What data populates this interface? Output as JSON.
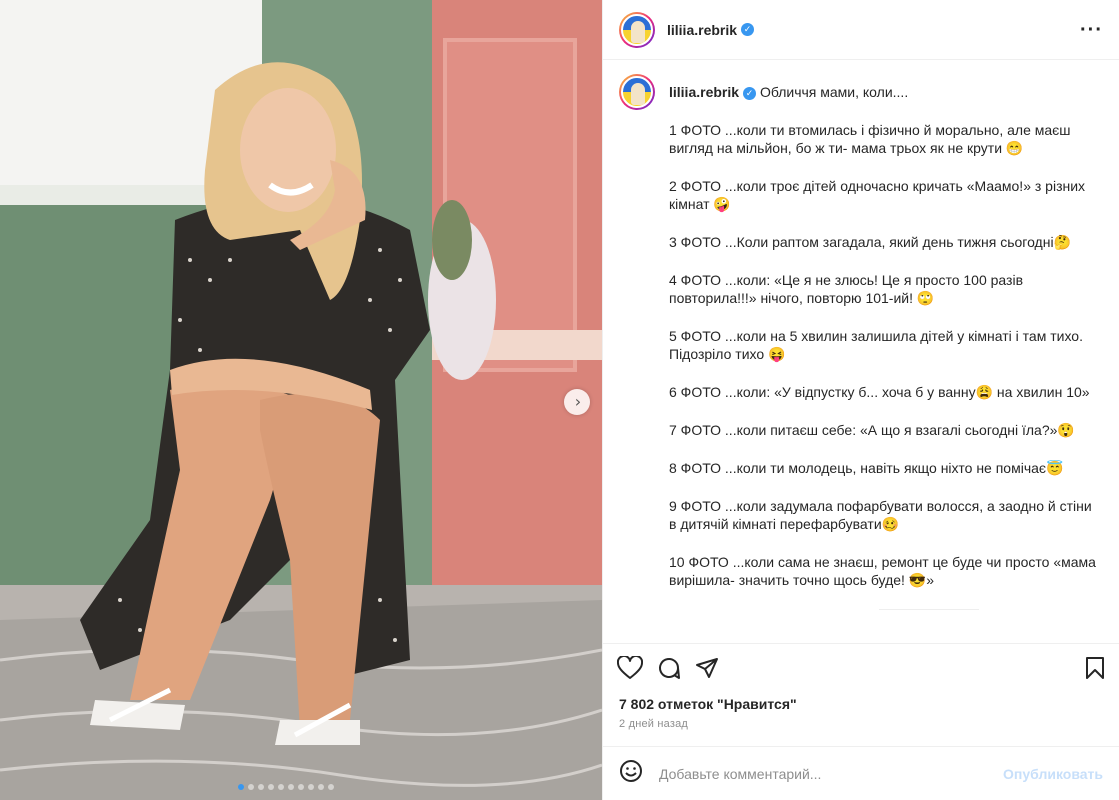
{
  "post": {
    "username": "liliia.rebrik",
    "verified_icon": "verified-badge-icon",
    "more_icon": "more-options-icon",
    "caption_title": "Обличчя мами, коли....",
    "caption_paragraphs": [
      "1 ФОТО ...коли ти втомилась і фізично й морально, але маєш вигляд на мільйон, бо ж ти- мама трьох як не крути 😁",
      "2 ФОТО ...коли троє дітей одночасно кричать «Маамо!» з різних кімнат 🤪",
      "3 ФОТО ...Коли раптом загадала, який день тижня сьогодні🤔",
      "4 ФОТО ...коли: «Це я не злюсь! Це я просто 100 разів повторила!!!» нічого, повторю 101-ий! 🙄",
      "5 ФОТО ...коли на 5 хвилин залишила дітей у кімнаті і там тихо.\nПідозріло тихо 😝",
      "6 ФОТО ...коли: «У відпустку б... хоча б у ванну😩  на хвилин 10»",
      "7 ФОТО ...коли питаєш себе: «А що я взагалі сьогодні їла?»😲",
      "8 ФОТО ...коли ти молодець, навіть якщо ніхто не помічає😇",
      "9 ФОТО ...коли задумала пофарбувати волосся, а заодно й стіни в дитячій кімнаті перефарбувати🥴",
      "10 ФОТО ...коли сама не знаєш, ремонт це буде чи просто «мама вирішила- значить точно щось буде! 😎»"
    ],
    "likes": "7 802 отметок \"Нравится\"",
    "time": "2 дней назад"
  },
  "media": {
    "next_icon": "chevron-right-icon",
    "next_glyph": "›",
    "slide_count": 10,
    "active_slide": 1
  },
  "actions": {
    "like_icon": "heart-icon",
    "comment_icon": "comment-icon",
    "share_icon": "paper-plane-icon",
    "save_icon": "bookmark-icon"
  },
  "comment_box": {
    "emoji_icon": "emoji-icon",
    "placeholder": "Добавьте комментарий...",
    "publish_label": "Опубликовать"
  },
  "colors": {
    "accent": "#3897f0",
    "publish_disabled": "#c7dffa",
    "meta_text": "#8e8e8e"
  }
}
